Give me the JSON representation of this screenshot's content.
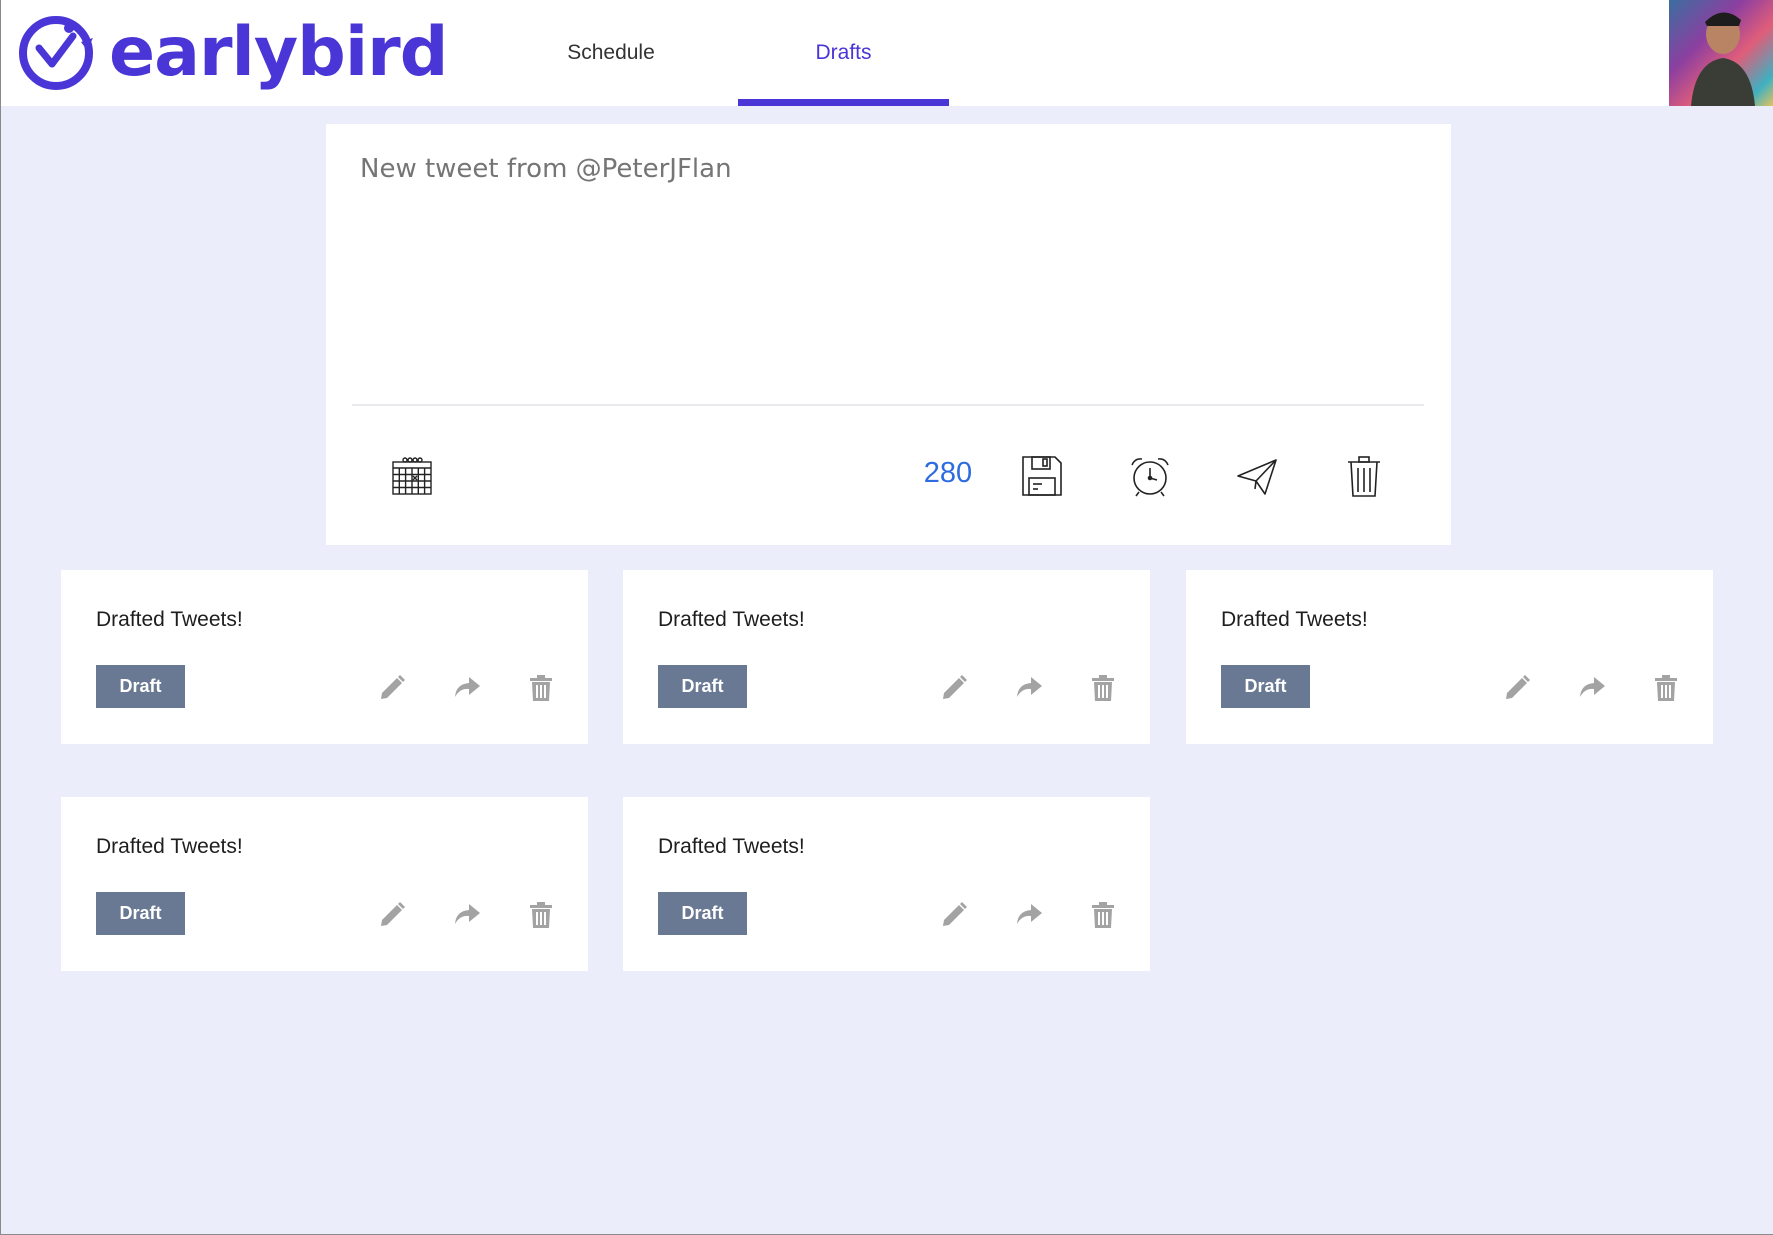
{
  "app": {
    "logo_text": "earlybird",
    "logo_icon": "bird-clock-icon"
  },
  "nav": {
    "tabs": [
      {
        "label": "Schedule",
        "active": false
      },
      {
        "label": "Drafts",
        "active": true
      }
    ]
  },
  "composer": {
    "placeholder": "New tweet from @PeterJFlan",
    "value": "",
    "char_count": "280",
    "tools": [
      "calendar-icon",
      "save-icon",
      "alarm-clock-icon",
      "send-icon",
      "trash-icon"
    ]
  },
  "drafts": [
    {
      "title": "Drafted Tweets!",
      "badge": "Draft"
    },
    {
      "title": "Drafted Tweets!",
      "badge": "Draft"
    },
    {
      "title": "Drafted Tweets!",
      "badge": "Draft"
    },
    {
      "title": "Drafted Tweets!",
      "badge": "Draft"
    },
    {
      "title": "Drafted Tweets!",
      "badge": "Draft"
    }
  ],
  "colors": {
    "brand": "#4a35d6",
    "background": "#ecedfb",
    "badge": "#697893",
    "count": "#2d6ce0",
    "muted_icon": "#a3a3a3"
  }
}
